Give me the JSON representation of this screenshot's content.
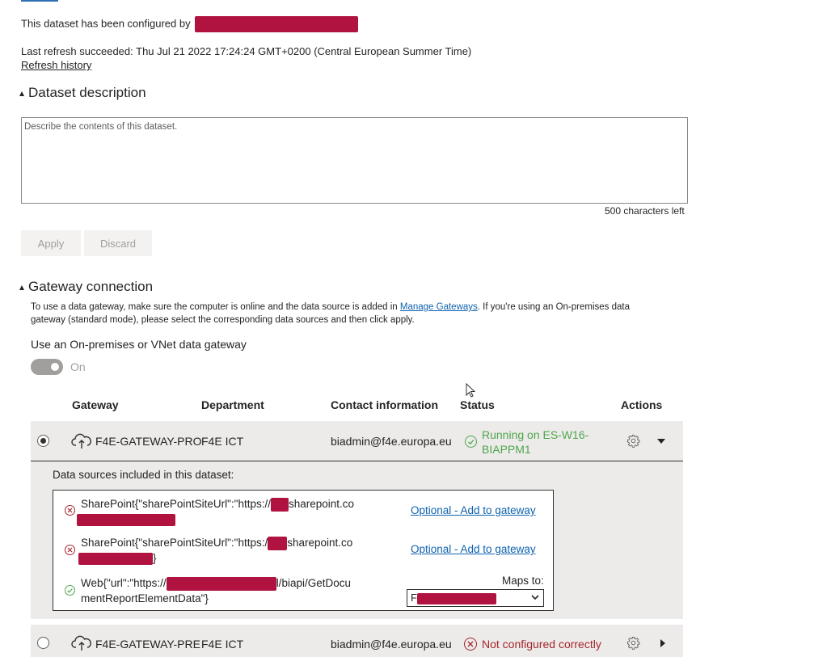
{
  "header": {
    "configured_by_text": "This dataset has been configured by",
    "last_refresh": "Last refresh succeeded: Thu Jul 21 2022 17:24:24 GMT+0200 (Central European Summer Time)",
    "refresh_history_link": "Refresh history"
  },
  "description": {
    "section_title": "Dataset description",
    "placeholder": "Describe the contents of this dataset.",
    "value": "",
    "chars_left": "500 characters left",
    "apply_label": "Apply",
    "discard_label": "Discard"
  },
  "gateway": {
    "section_title": "Gateway connection",
    "info_part1": "To use a data gateway, make sure the computer is online and the data source is added in",
    "manage_link": "Manage Gateways",
    "info_part2": ". If you're using an On-premises data",
    "info_line2": "gateway (standard mode), please select the corresponding data sources and then click apply.",
    "use_gateway_label": "Use an On-premises or VNet data gateway",
    "toggle_state": "On",
    "columns": {
      "gateway": "Gateway",
      "department": "Department",
      "contact": "Contact information",
      "status": "Status",
      "actions": "Actions"
    },
    "rows": [
      {
        "name": "F4E-GATEWAY-PRO",
        "department": "F4E ICT",
        "contact": "biadmin@f4e.europa.eu",
        "status_line1": "Running on ES-W16-",
        "status_line2": "BIAPPM1",
        "status_color": "#4da64d",
        "selected": true
      },
      {
        "name": "F4E-GATEWAY-PRE",
        "department": "F4E ICT",
        "contact": "biadmin@f4e.europa.eu",
        "status_line1": "Not configured correctly",
        "status_color": "#a4262c",
        "selected": false
      }
    ],
    "data_sources": {
      "heading": "Data sources included in this dataset:",
      "items": [
        {
          "line1_prefix": "SharePoint{\"sharePointSiteUrl\":\"https://",
          "line1_suffix": "sharepoint.co",
          "action_link": "Optional - Add to gateway",
          "status": "error"
        },
        {
          "line1_prefix": "SharePoint{\"sharePointSiteUrl\":\"https:/",
          "line1_suffix": "sharepoint.co",
          "line2_suffix": "}",
          "action_link": "Optional - Add to gateway",
          "status": "error"
        },
        {
          "line1_prefix": "Web{\"url\":\"https://",
          "line1_suffix": "l/biapi/GetDocu",
          "line2": "mentReportElementData\"}",
          "maps_to_label": "Maps to:",
          "maps_to_value": "F",
          "status": "ok"
        }
      ]
    }
  },
  "colors": {
    "redaction": "#b0133f",
    "link": "#0f62ae",
    "row_bg": "#edebe9",
    "ok": "#4da64d",
    "error": "#a4262c"
  }
}
